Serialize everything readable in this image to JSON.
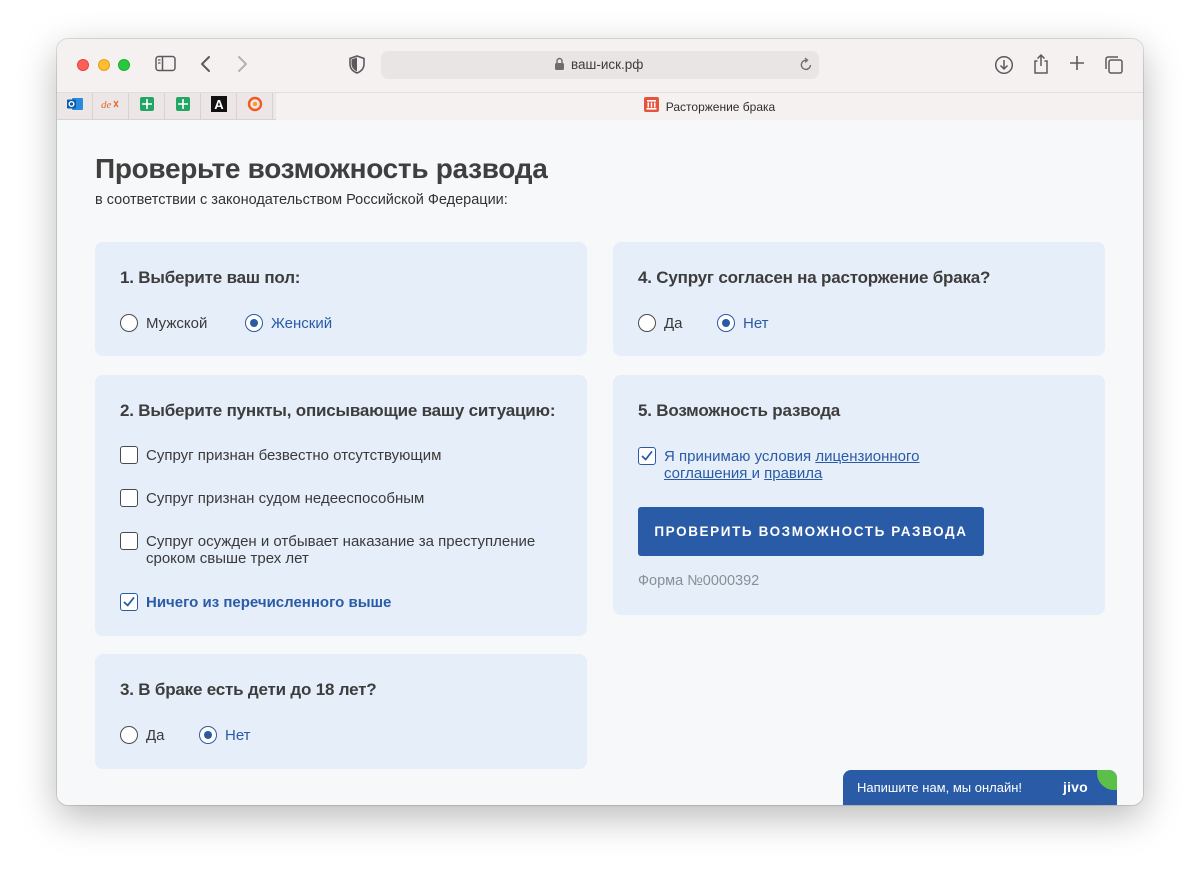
{
  "browser": {
    "url": "ваш-иск.рф",
    "tab_title": "Расторжение брака",
    "pinned_tabs": [
      "outlook-icon",
      "devtools-icon",
      "sheets-icon",
      "sheets-icon",
      "font-icon",
      "grafana-icon"
    ]
  },
  "page": {
    "title": "Проверьте возможность развода",
    "subtitle": "в соответствии с законодательством Российской Федерации:"
  },
  "q1": {
    "title": "1. Выберите ваш пол:",
    "options": [
      {
        "label": "Мужской",
        "selected": false
      },
      {
        "label": "Женский",
        "selected": true
      }
    ]
  },
  "q2": {
    "title": "2. Выберите пункты, описывающие вашу ситуацию:",
    "options": [
      {
        "label": "Супруг признан безвестно отсутствующим",
        "checked": false
      },
      {
        "label": "Супруг признан судом недееспособным",
        "checked": false
      },
      {
        "label": "Супруг осужден и отбывает наказание за преступление сроком свыше трех лет",
        "checked": false
      },
      {
        "label": "Ничего из перечисленного выше",
        "checked": true
      }
    ]
  },
  "q3": {
    "title": "3. В браке есть дети до 18 лет?",
    "options": [
      {
        "label": "Да",
        "selected": false
      },
      {
        "label": "Нет",
        "selected": true
      }
    ]
  },
  "q4": {
    "title": "4. Супруг согласен на расторжение брака?",
    "options": [
      {
        "label": "Да",
        "selected": false
      },
      {
        "label": "Нет",
        "selected": true
      }
    ]
  },
  "q5": {
    "title": "5. Возможность развода",
    "agree_prefix": "Я принимаю условия ",
    "agree_link1": "лицензионного соглашения ",
    "agree_mid": "и ",
    "agree_link2": "правила",
    "agree_checked": true,
    "button": "ПРОВЕРИТЬ ВОЗМОЖНОСТЬ РАЗВОДА",
    "form_number": "Форма №0000392"
  },
  "chat": {
    "text": "Напишите нам, мы онлайн!",
    "logo": "jivo"
  },
  "colors": {
    "accent": "#2a5ba6",
    "card_bg": "#e6eef9",
    "page_bg": "#f7f8fa"
  }
}
